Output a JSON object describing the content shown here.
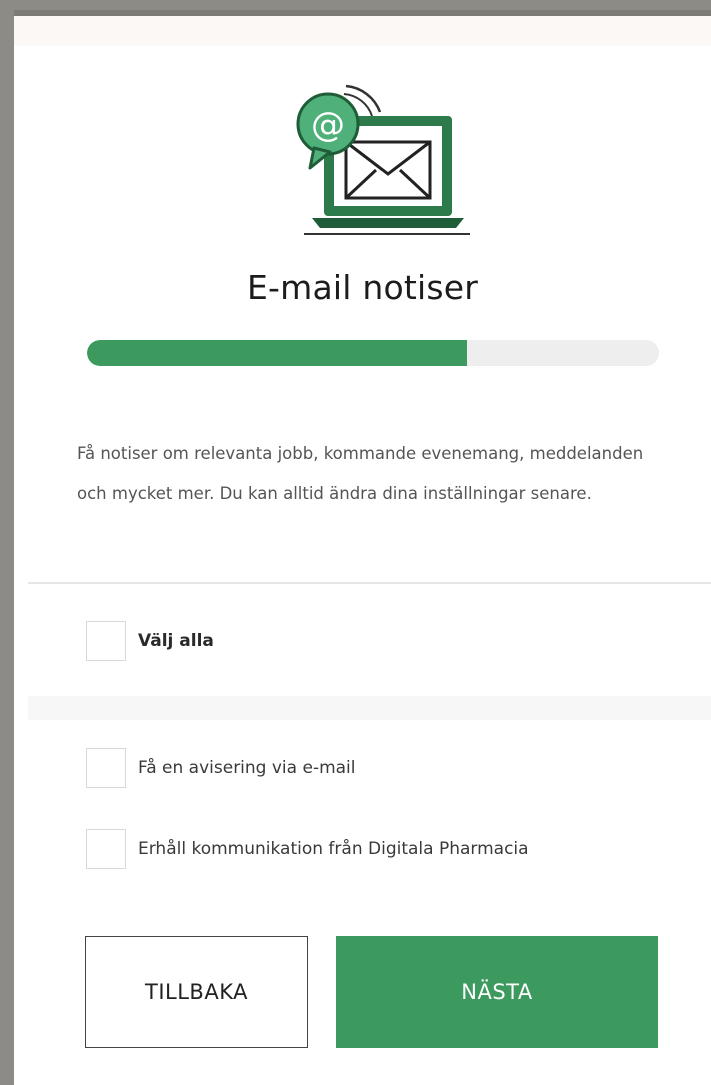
{
  "title": "E-mail notiser",
  "progress": {
    "fraction": 0.665
  },
  "description": "Få notiser om relevanta jobb, kommande evenemang, meddelanden och mycket mer. Du kan alltid ändra dina inställningar senare.",
  "options": {
    "select_all": {
      "label": "Välj alla",
      "checked": false
    },
    "items": [
      {
        "label": "Få en avisering via e-mail",
        "checked": false
      },
      {
        "label": "Erhåll kommunikation från Digitala Pharmacia",
        "checked": false
      }
    ]
  },
  "buttons": {
    "back_label": "TILLBAKA",
    "next_label": "NÄSTA"
  },
  "icons": {
    "illustration": "laptop-email-icon",
    "bubble_symbol": "@"
  },
  "colors": {
    "accent": "#3c9a5f",
    "dark_green": "#1f6b3f",
    "track": "#eeeeee"
  }
}
